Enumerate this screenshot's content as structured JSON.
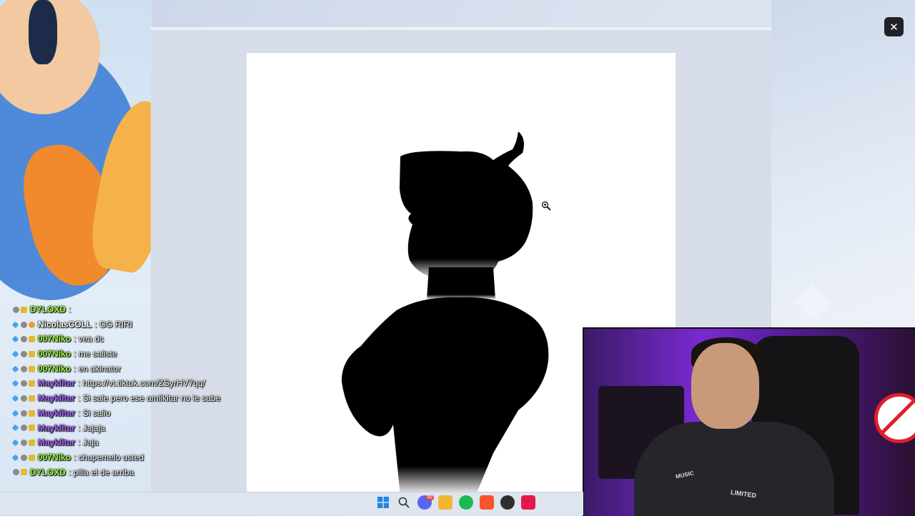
{
  "viewer": {
    "close_label": "✕"
  },
  "chat": {
    "messages": [
      {
        "user": "DYLOXD",
        "text": ":",
        "color": "#9cff3a",
        "badges": [
          "b1",
          "b2"
        ]
      },
      {
        "user": "NicolasCOLL",
        "text": ": GG RIRI",
        "color": "#ffffff",
        "badges": [
          "b3",
          "b1",
          "b4"
        ]
      },
      {
        "user": "007Niko",
        "text": ": vea dc",
        "color": "#9cff3a",
        "badges": [
          "b3",
          "b1",
          "b2"
        ]
      },
      {
        "user": "007Niko",
        "text": ": me saliste",
        "color": "#9cff3a",
        "badges": [
          "b3",
          "b1",
          "b2"
        ]
      },
      {
        "user": "007Niko",
        "text": ": en akinator",
        "color": "#9cff3a",
        "badges": [
          "b3",
          "b1",
          "b2"
        ]
      },
      {
        "user": "Mayklitar",
        "text": ": https://vt.tiktok.com/ZSyrHV7qq/",
        "color": "#a866ff",
        "badges": [
          "b3",
          "b1",
          "b2"
        ]
      },
      {
        "user": "Mayklitar",
        "text": ": Si sale pero ese amiikitar no le sabe",
        "color": "#a866ff",
        "badges": [
          "b3",
          "b1",
          "b2"
        ]
      },
      {
        "user": "Mayklitar",
        "text": ": Si salio",
        "color": "#a866ff",
        "badges": [
          "b3",
          "b1",
          "b2"
        ]
      },
      {
        "user": "Mayklitar",
        "text": ": Jajaja",
        "color": "#a866ff",
        "badges": [
          "b3",
          "b1",
          "b2"
        ]
      },
      {
        "user": "Mayklitar",
        "text": ": Jaja",
        "color": "#a866ff",
        "badges": [
          "b3",
          "b1",
          "b2"
        ]
      },
      {
        "user": "007Niko",
        "text": ": chupemelo usted",
        "color": "#9cff3a",
        "badges": [
          "b3",
          "b1",
          "b2"
        ]
      },
      {
        "user": "DYLOXD",
        "text": ": pilla el de arriba",
        "color": "#9cff3a",
        "badges": [
          "b1",
          "b2"
        ]
      }
    ]
  },
  "taskbar": {
    "icons": [
      {
        "name": "windows-start-icon",
        "color": "#1e88e5"
      },
      {
        "name": "search-icon",
        "color": "#333333"
      },
      {
        "name": "discord-icon",
        "color": "#5865f2",
        "badge": "99"
      },
      {
        "name": "file-explorer-icon",
        "color": "#f2b632"
      },
      {
        "name": "spotify-icon",
        "color": "#1db954"
      },
      {
        "name": "brave-icon",
        "color": "#fb542b"
      },
      {
        "name": "obs-icon",
        "color": "#302e31"
      },
      {
        "name": "tiktok-icon",
        "color": "#e3174a"
      }
    ]
  },
  "webcam": {
    "shirt_text_1": "MUSIC",
    "shirt_text_2": "LIMITED"
  }
}
